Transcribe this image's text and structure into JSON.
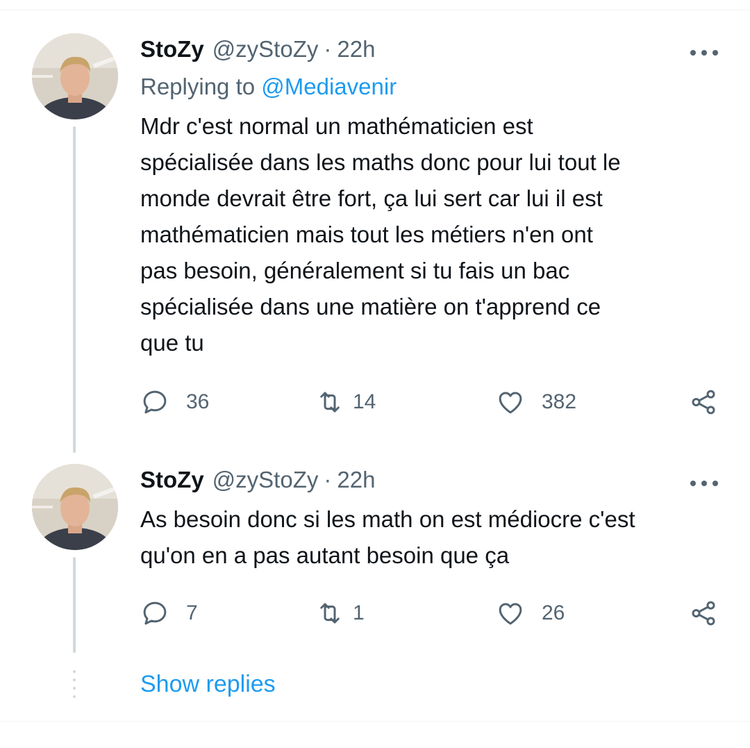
{
  "tweets": [
    {
      "name": "StoZy",
      "handle": "@zyStoZy",
      "separator": "·",
      "time": "22h",
      "replying_label": "Replying to",
      "replying_to": "@Mediavenir",
      "lines": [
        "Mdr c'est normal un mathématicien est",
        "spécialisée dans les maths donc pour lui tout le",
        "monde devrait être fort, ça lui sert car lui il est",
        "mathématicien mais tout les métiers n'en ont",
        "pas besoin, généralement si tu fais un bac",
        "spécialisée dans une matière on t'apprend ce",
        "que tu"
      ],
      "replies": "36",
      "retweets": "14",
      "likes": "382"
    },
    {
      "name": "StoZy",
      "handle": "@zyStoZy",
      "separator": "·",
      "time": "22h",
      "lines": [
        "As besoin donc si les math on est médiocre c'est",
        "qu'on en a pas autant besoin que ça"
      ],
      "replies": "7",
      "retweets": "1",
      "likes": "26"
    }
  ],
  "show_replies": "Show replies",
  "icons": {
    "reply": "reply-icon",
    "retweet": "retweet-icon",
    "like": "heart-icon",
    "share": "share-icon",
    "more": "more-icon"
  },
  "colors": {
    "text": "#0f1419",
    "secondary": "#536471",
    "accent": "#1d9bf0",
    "thread_line": "#cfd9de"
  }
}
